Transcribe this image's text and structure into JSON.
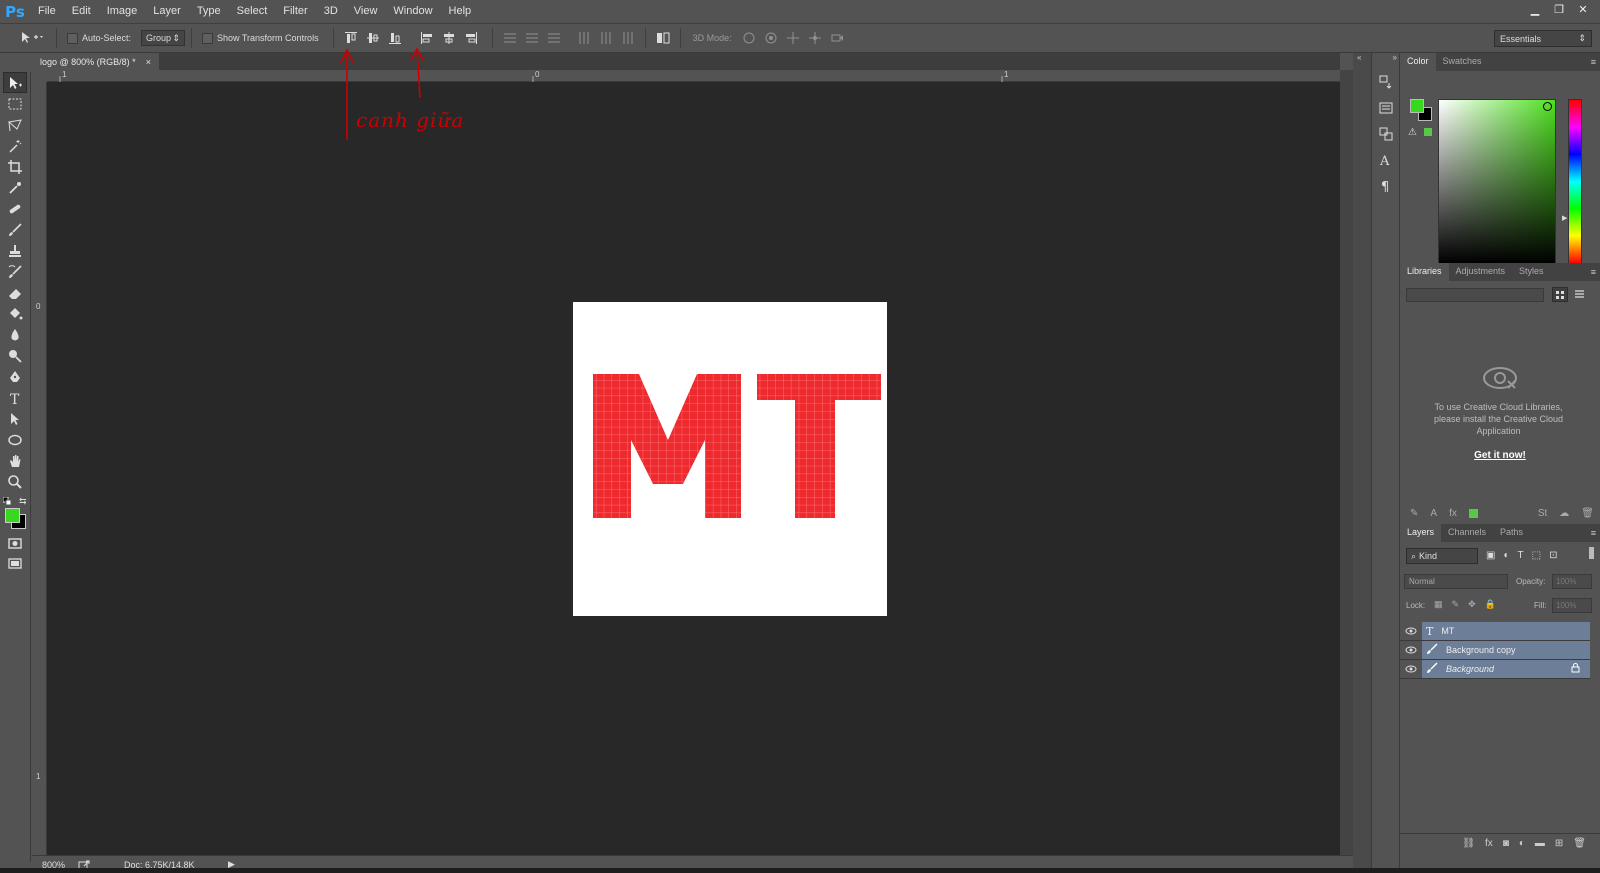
{
  "app": {
    "logo": "Ps"
  },
  "menu": [
    "File",
    "Edit",
    "Image",
    "Layer",
    "Type",
    "Select",
    "Filter",
    "3D",
    "View",
    "Window",
    "Help"
  ],
  "window_controls": {
    "minimize": "▁",
    "restore": "❐",
    "close": "✕"
  },
  "options_bar": {
    "auto_select_label": "Auto-Select:",
    "auto_select_value": "Group",
    "transform_label": "Show Transform Controls",
    "mode_3d_label": "3D Mode:",
    "workspace": "Essentials"
  },
  "document": {
    "tab_title": "logo @ 800% (RGB/8) *",
    "tab_close": "×",
    "canvas_text": "MT",
    "text_color": "#ee1c24"
  },
  "rulers": {
    "top": [
      "1",
      "0",
      "1"
    ],
    "left": [
      "0",
      "1"
    ]
  },
  "annotation": {
    "text": "canh giữa",
    "color": "#cc0000"
  },
  "status": {
    "zoom": "800%",
    "doc_info": "Doc: 6.75K/14.8K"
  },
  "color_panel": {
    "tabs": [
      "Color",
      "Swatches"
    ],
    "foreground": "#37d81e",
    "background": "#000000"
  },
  "libraries_panel": {
    "tabs": [
      "Libraries",
      "Adjustments",
      "Styles"
    ],
    "message": "To use Creative Cloud Libraries, please install the Creative Cloud Application",
    "link": "Get it now!"
  },
  "layers_panel": {
    "tabs": [
      "Layers",
      "Channels",
      "Paths"
    ],
    "filter_label": "Kind",
    "blend_mode": "Normal",
    "opacity_label": "Opacity:",
    "opacity_value": "100%",
    "lock_label": "Lock:",
    "fill_label": "Fill:",
    "fill_value": "100%",
    "layers": [
      {
        "name": "MT",
        "type": "text"
      },
      {
        "name": "Background copy",
        "type": "brush"
      },
      {
        "name": "Background",
        "type": "brush",
        "locked": true
      }
    ]
  }
}
